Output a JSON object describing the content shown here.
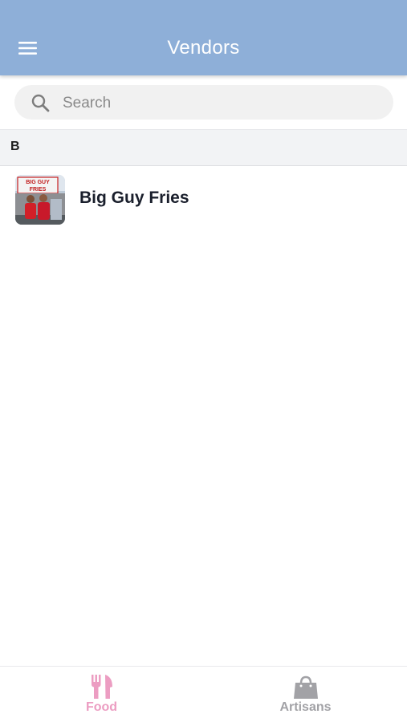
{
  "header": {
    "title": "Vendors",
    "menu_icon": "hamburger-menu-icon",
    "background_color": "#8eafd8"
  },
  "search": {
    "placeholder": "Search",
    "value": "",
    "icon": "search-icon"
  },
  "sections": [
    {
      "letter": "B",
      "vendors": [
        {
          "name": "Big Guy Fries",
          "thumbnail": "vendor-photo"
        }
      ]
    }
  ],
  "tabbar": {
    "tabs": [
      {
        "label": "Food",
        "icon": "fork-knife-icon",
        "active": true,
        "color": "#ec9dc2"
      },
      {
        "label": "Artisans",
        "icon": "shopping-bag-icon",
        "active": false,
        "color": "#a2a2a6"
      }
    ]
  }
}
